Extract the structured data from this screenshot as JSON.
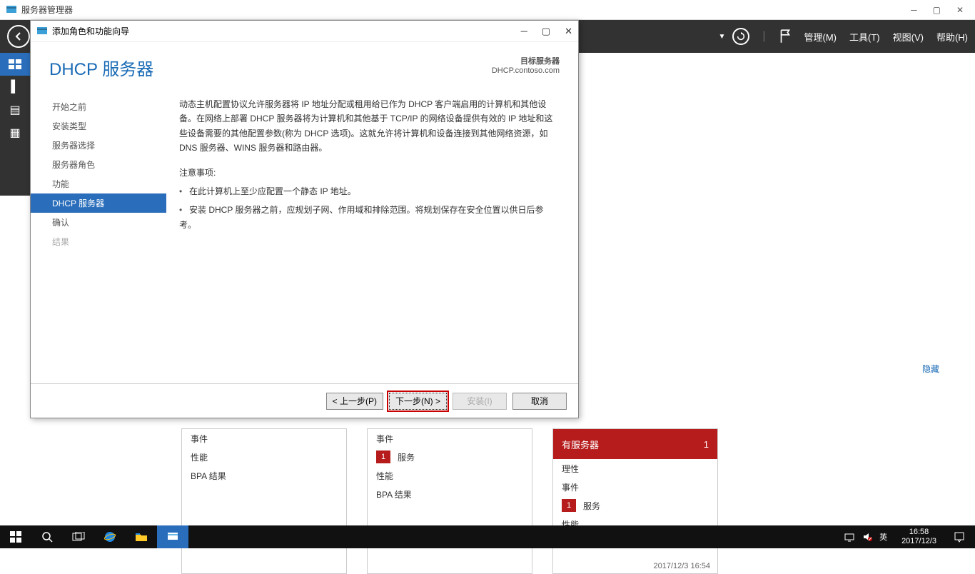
{
  "main_window": {
    "title": "服务器管理器",
    "menu": {
      "manage": "管理(M)",
      "tools": "工具(T)",
      "view": "视图(V)",
      "help": "帮助(H)"
    }
  },
  "welcome": {
    "hide": "隐藏"
  },
  "tiles": {
    "all_servers_header": "有服务器",
    "all_servers_count": "1",
    "rows": {
      "manageability": "理性",
      "events": "事件",
      "services": "服务",
      "performance": "性能",
      "bpa": "BPA 结果"
    },
    "timestamp": "2017/12/3 16:54",
    "badge1": "1",
    "badge1b": "1"
  },
  "wizard": {
    "window_title": "添加角色和功能向导",
    "page_title": "DHCP 服务器",
    "target_label": "目标服务器",
    "target_value": "DHCP.contoso.com",
    "nav": {
      "before": "开始之前",
      "install_type": "安装类型",
      "server_select": "服务器选择",
      "server_roles": "服务器角色",
      "features": "功能",
      "dhcp": "DHCP 服务器",
      "confirm": "确认",
      "results": "结果"
    },
    "paragraph": "动态主机配置协议允许服务器将 IP 地址分配或租用给已作为 DHCP 客户端启用的计算机和其他设备。在网络上部署 DHCP 服务器将为计算机和其他基于 TCP/IP 的网络设备提供有效的 IP 地址和这些设备需要的其他配置参数(称为 DHCP 选项)。这就允许将计算机和设备连接到其他网络资源，如 DNS 服务器、WINS 服务器和路由器。",
    "notice_label": "注意事项:",
    "bullet1": "在此计算机上至少应配置一个静态 IP 地址。",
    "bullet2": "安装 DHCP 服务器之前，应规划子网、作用域和排除范围。将规划保存在安全位置以供日后参考。",
    "buttons": {
      "prev": "< 上一步(P)",
      "next": "下一步(N) >",
      "install": "安装(I)",
      "cancel": "取消"
    }
  },
  "taskbar": {
    "ime": "英",
    "time": "16:58",
    "date": "2017/12/3"
  }
}
